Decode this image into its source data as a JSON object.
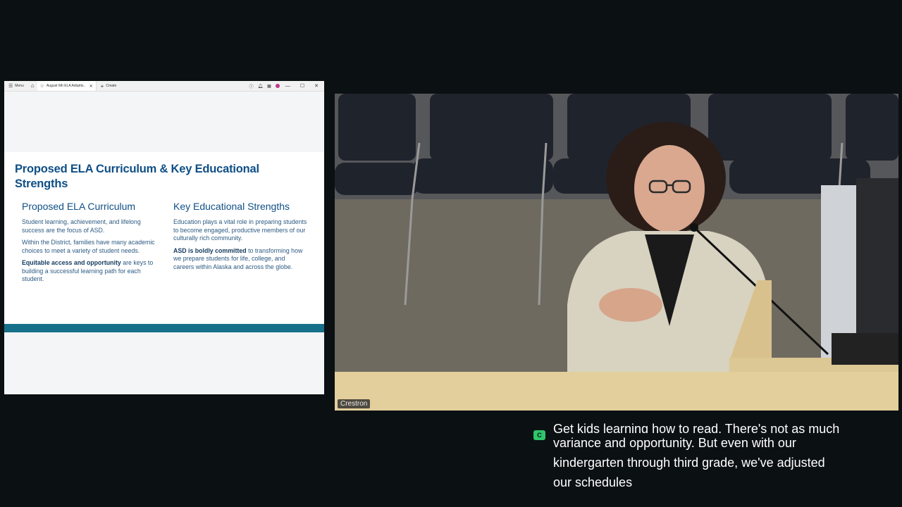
{
  "browser": {
    "menu_label": "Menu",
    "tab_title": "August 6th ELA Adoptio..",
    "new_tab_label": "Create"
  },
  "slide": {
    "title": "Proposed ELA Curriculum & Key Educational Strengths",
    "left": {
      "heading": "Proposed ELA Curriculum",
      "p1": "Student learning, achievement, and lifelong success are the focus of ASD.",
      "p2": "Within the District, families have many academic choices to meet a variety of student needs.",
      "p3_bold": "Equitable access and opportunity",
      "p3_rest": " are keys to building a successful learning path for each student."
    },
    "right": {
      "heading": "Key Educational Strengths",
      "p1": "Education plays a vital role in preparing students to become engaged, productive members of our culturally rich community.",
      "p2_bold": "ASD is boldly committed",
      "p2_rest": " to transforming how we prepare students for life, college, and careers within Alaska and across the globe."
    }
  },
  "camera": {
    "label": "Crestron"
  },
  "caption": {
    "badge": "C",
    "line0": "Get kids learning how to read. There's not as much",
    "line1": "variance and opportunity. But even with our",
    "line2": "kindergarten through third grade, we've adjusted",
    "line3": "our schedules"
  },
  "colors": {
    "slide_title": "#0f4f86",
    "slide_bar": "#16708a",
    "caption_badge": "#2ec66a"
  }
}
